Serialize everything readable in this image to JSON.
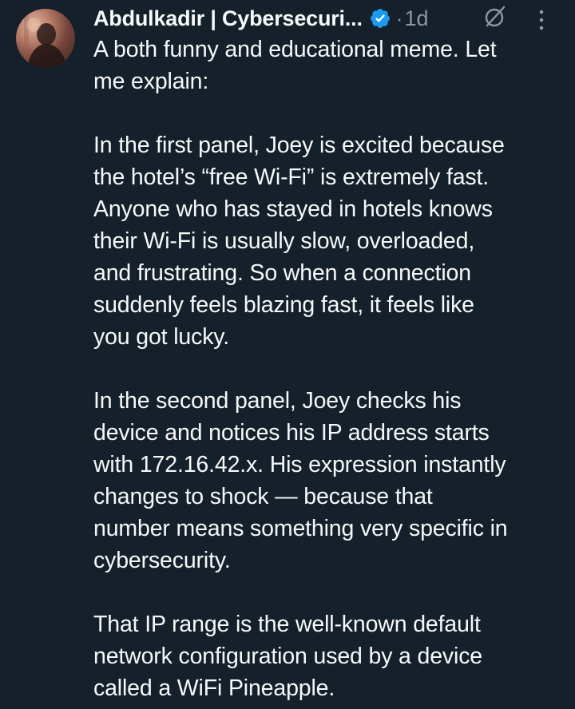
{
  "author": {
    "display_name": "Abdulkadir | Cybersecuri...",
    "verified": true,
    "separator": "·",
    "timestamp": "1d"
  },
  "icons": {
    "avatar": "profile-avatar",
    "verified": "verified-badge-icon",
    "grok": "grok-icon",
    "more": "more-options-icon"
  },
  "colors": {
    "background": "#15202b",
    "text": "#f7f9f9",
    "secondary": "#8b98a5",
    "verified_blue": "#1d9bf0"
  },
  "paragraphs": [
    {
      "lines": [
        "A both funny and educational meme. Let",
        "me explain:"
      ]
    },
    {
      "lines": [
        "In the first panel, Joey is excited because",
        "the hotel’s “free Wi-Fi” is extremely fast.",
        "Anyone who has stayed in hotels knows",
        "their Wi-Fi is usually slow, overloaded,",
        "and frustrating. So when a connection",
        "suddenly feels blazing fast, it feels like",
        "you got lucky."
      ]
    },
    {
      "lines": [
        "In the second panel, Joey checks his",
        "device and notices his IP address starts",
        "with 172.16.42.x. His expression instantly",
        "changes to shock — because that",
        "number means something very specific in",
        "cybersecurity."
      ]
    },
    {
      "lines": [
        "That IP range is the well-known default",
        "network configuration used by a device",
        "called a WiFi Pineapple."
      ]
    }
  ]
}
